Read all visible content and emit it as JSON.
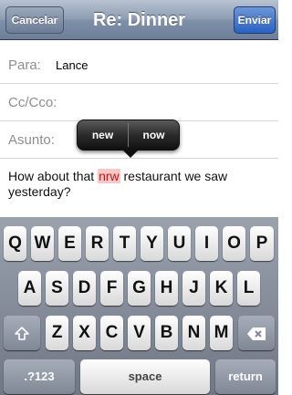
{
  "navbar": {
    "cancel_label": "Cancelar",
    "title": "Re: Dinner",
    "send_label": "Enviar"
  },
  "fields": {
    "to": {
      "label": "Para:",
      "value": "Lance"
    },
    "cc": {
      "label": "Cc/Cco:"
    },
    "subject": {
      "label": "Asunto:"
    }
  },
  "body": {
    "text_before": "How about that ",
    "misspelled_word": "nrw",
    "text_after": " restaurant we saw yesterday?"
  },
  "suggestions": [
    "new",
    "now"
  ],
  "keyboard": {
    "row1": [
      "Q",
      "W",
      "E",
      "R",
      "T",
      "Y",
      "U",
      "I",
      "O",
      "P"
    ],
    "row2": [
      "A",
      "S",
      "D",
      "F",
      "G",
      "H",
      "J",
      "K",
      "L"
    ],
    "row3": [
      "Z",
      "X",
      "C",
      "V",
      "B",
      "N",
      "M"
    ],
    "numbers_label": ".?123",
    "space_label": "space",
    "return_label": "return",
    "shift_icon": "shift-icon",
    "delete_icon": "backspace-icon"
  },
  "colors": {
    "navbar": "#8d9db3",
    "send_button": "#2a62c4",
    "misspelled_highlight": "#f6c8c8"
  }
}
